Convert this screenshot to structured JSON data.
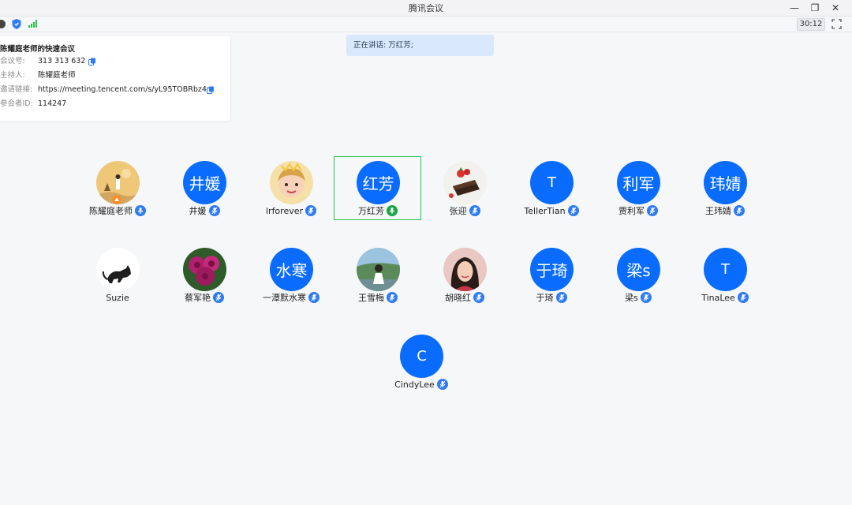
{
  "window": {
    "title": "腾讯会议",
    "timer": "30:12"
  },
  "meeting_info": {
    "title": "陈耀庭老师的快速会议",
    "rows": [
      {
        "label": "会议号:",
        "value": "313 313 632"
      },
      {
        "label": "主持人:",
        "value": "陈耀庭老师"
      },
      {
        "label": "邀请链接:",
        "value": "https://meeting.tencent.com/s/yL95TOBRbz4p"
      },
      {
        "label": "参会者ID:",
        "value": "114247"
      }
    ]
  },
  "speaking": {
    "text": "正在讲话: 万红芳;"
  },
  "participants": [
    {
      "name": "陈耀庭老师",
      "avatar": "photo-landscape",
      "mic": "mic-icon"
    },
    {
      "name": "井媛",
      "avatar_text": "井媛",
      "mic": "mic-icon"
    },
    {
      "name": "lrforever",
      "avatar": "photo-child",
      "mic": "mic-icon"
    },
    {
      "name": "万红芳",
      "avatar_text": "红芳",
      "mic": "mic-speaking-icon",
      "speaking": true
    },
    {
      "name": "张迎",
      "avatar": "photo-cake",
      "mic": "mic-icon"
    },
    {
      "name": "TellerTian",
      "avatar_text": "T",
      "mic": "mic-icon"
    },
    {
      "name": "贾利军",
      "avatar_text": "利军",
      "mic": "mic-icon"
    },
    {
      "name": "王玮婧",
      "avatar_text": "玮婧",
      "mic": "mic-icon"
    },
    {
      "name": "Suzie",
      "avatar": "photo-cat"
    },
    {
      "name": "蔡军艳",
      "avatar": "photo-flowers",
      "mic": "mic-icon"
    },
    {
      "name": "一潭默水寒",
      "avatar_text": "水寒",
      "mic": "mic-icon"
    },
    {
      "name": "王雪梅",
      "avatar": "photo-person-outdoor",
      "mic": "mic-icon"
    },
    {
      "name": "胡晓红",
      "avatar": "photo-woman",
      "mic": "mic-icon"
    },
    {
      "name": "于琦",
      "avatar_text": "于琦",
      "mic": "mic-icon"
    },
    {
      "name": "梁s",
      "avatar_text": "梁s",
      "mic": "mic-icon"
    },
    {
      "name": "TinaLee",
      "avatar_text": "T",
      "mic": "mic-icon"
    },
    {
      "name": "CindyLee",
      "avatar_text": "C",
      "mic": "mic-icon"
    }
  ],
  "colors": {
    "avatar_blue": "#0a6cff",
    "mic_blue": "#2f7bf6",
    "speaking_green": "#25c254",
    "banner_bg": "#d9e8fb"
  }
}
